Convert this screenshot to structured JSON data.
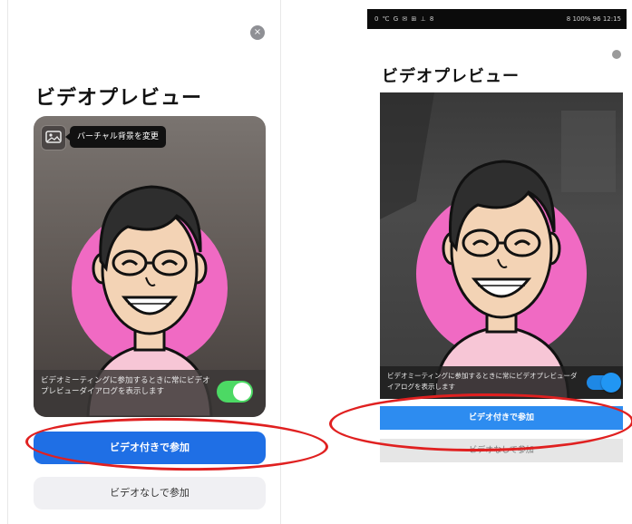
{
  "left_screen": {
    "title": "ビデオプレビュー",
    "close_glyph": "×",
    "virtual_background_tooltip": "バーチャル背景を変更",
    "toggle_label": "ビデオミーティングに参加するときに常にビデオプレビューダイアログを表示します",
    "toggle_on": true,
    "join_with_video_label": "ビデオ付きで参加",
    "join_without_video_label": "ビデオなしで参加"
  },
  "right_screen": {
    "status_left": "0 ℃ G ✉ ⊞ ⊥ 8",
    "status_right": "8 100% 96 12:15",
    "title": "ビデオプレビュー",
    "toggle_label": "ビデオミーティングに参加するときに常にビデオプレビューダイアログを表示します",
    "toggle_on": true,
    "join_with_video_label": "ビデオ付きで参加",
    "join_without_video_label": "ビデオなしで参加"
  },
  "colors": {
    "ios_accent": "#1f6fe5",
    "ios_switch": "#4cd964",
    "android_accent": "#2d8cf0",
    "annotation": "#e02020",
    "avatar_circle": "#f06ac3"
  },
  "icons": {
    "close": "close-icon",
    "virtual_background": "image-icon"
  }
}
